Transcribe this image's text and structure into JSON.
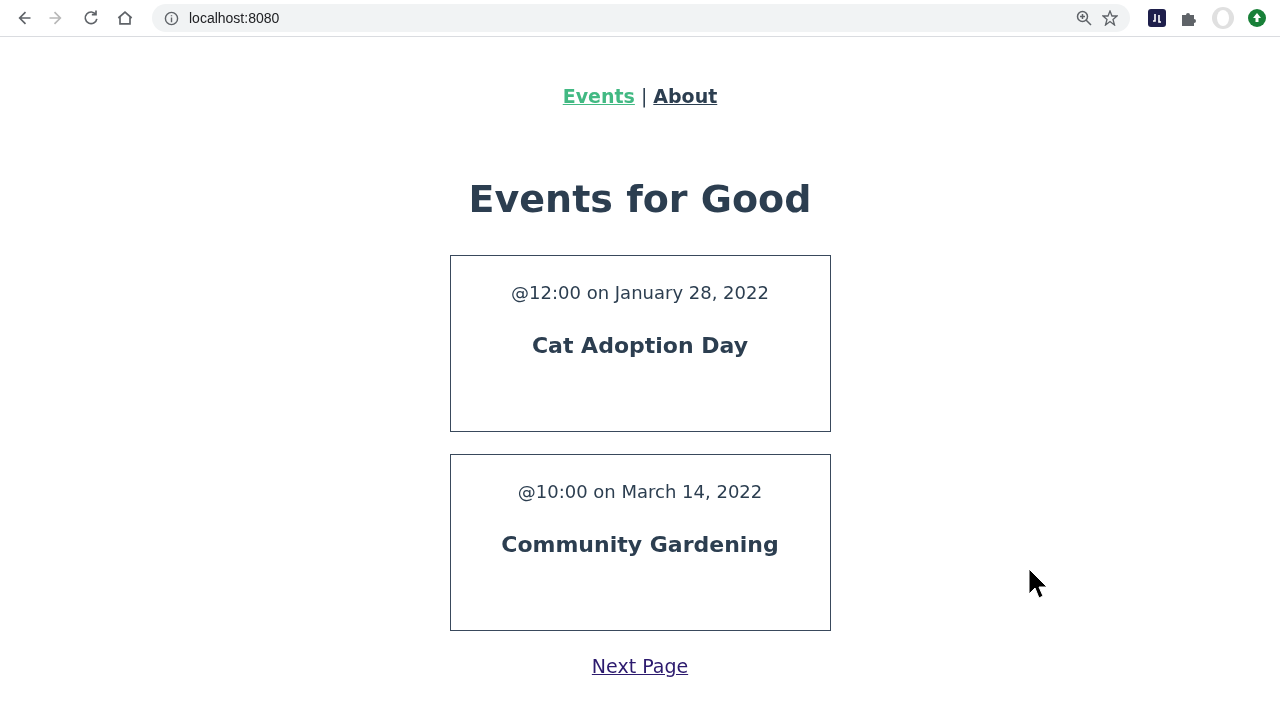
{
  "browser": {
    "nav_buttons": [
      {
        "kind": "back",
        "disabled": false
      },
      {
        "kind": "forward",
        "disabled": true
      },
      {
        "kind": "reload",
        "disabled": false
      },
      {
        "kind": "home",
        "disabled": false
      }
    ],
    "address": "localhost:8080"
  },
  "nav": {
    "links": [
      {
        "label": "Events",
        "selected": true
      },
      {
        "label": "About",
        "selected": false
      }
    ],
    "separator": "|"
  },
  "title": "Events for Good",
  "events": [
    {
      "when": "@12:00 on January 28, 2022",
      "name": "Cat Adoption Day"
    },
    {
      "when": "@10:00 on March 14, 2022",
      "name": "Community Gardening"
    }
  ],
  "next_link": "Next Page"
}
